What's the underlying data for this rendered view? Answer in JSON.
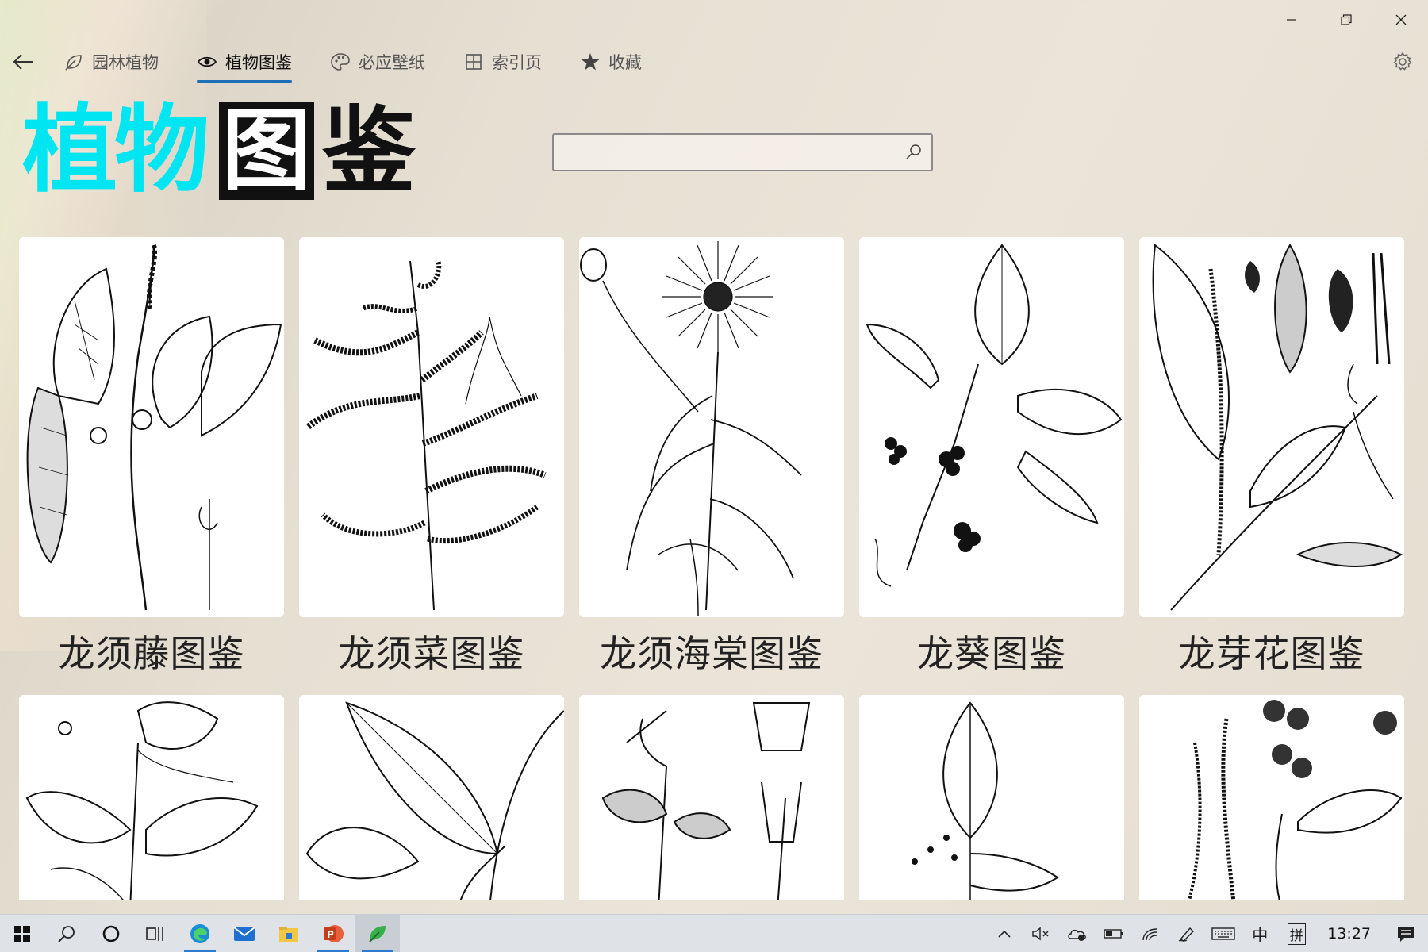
{
  "window": {
    "controls": [
      "minimize-icon",
      "restore-icon",
      "close-icon"
    ]
  },
  "nav": {
    "back_icon": "back-arrow-icon",
    "tabs": [
      {
        "label": "园林植物",
        "icon": "leaf-icon",
        "active": false
      },
      {
        "label": "植物图鉴",
        "icon": "eye-icon",
        "active": true
      },
      {
        "label": "必应壁纸",
        "icon": "palette-icon",
        "active": false
      },
      {
        "label": "索引页",
        "icon": "grid-icon",
        "active": false
      },
      {
        "label": "收藏",
        "icon": "star-icon",
        "active": false
      }
    ],
    "settings_icon": "gear-icon",
    "accent": "#1d6fb5"
  },
  "header": {
    "title_cyan": "植物",
    "title_boxed": "图",
    "title_plain": "鉴",
    "title_cyan_color": "#00e5f2"
  },
  "search": {
    "value": "",
    "placeholder": "",
    "icon": "search-icon"
  },
  "cards_row1": [
    {
      "caption": "龙须藤图鉴"
    },
    {
      "caption": "龙须菜图鉴"
    },
    {
      "caption": "龙须海棠图鉴"
    },
    {
      "caption": "龙葵图鉴"
    },
    {
      "caption": "龙芽花图鉴"
    }
  ],
  "cards_row2_count": 5,
  "taskbar": {
    "apps": [
      "windows-start-icon",
      "search-icon",
      "cortana-icon",
      "task-view-icon",
      "edge-icon",
      "mail-icon",
      "file-explorer-icon",
      "powerpoint-icon",
      "plant-app-icon"
    ],
    "tray": {
      "ime_lang": "中",
      "ime_mode": "拼",
      "time": "13:27"
    }
  }
}
